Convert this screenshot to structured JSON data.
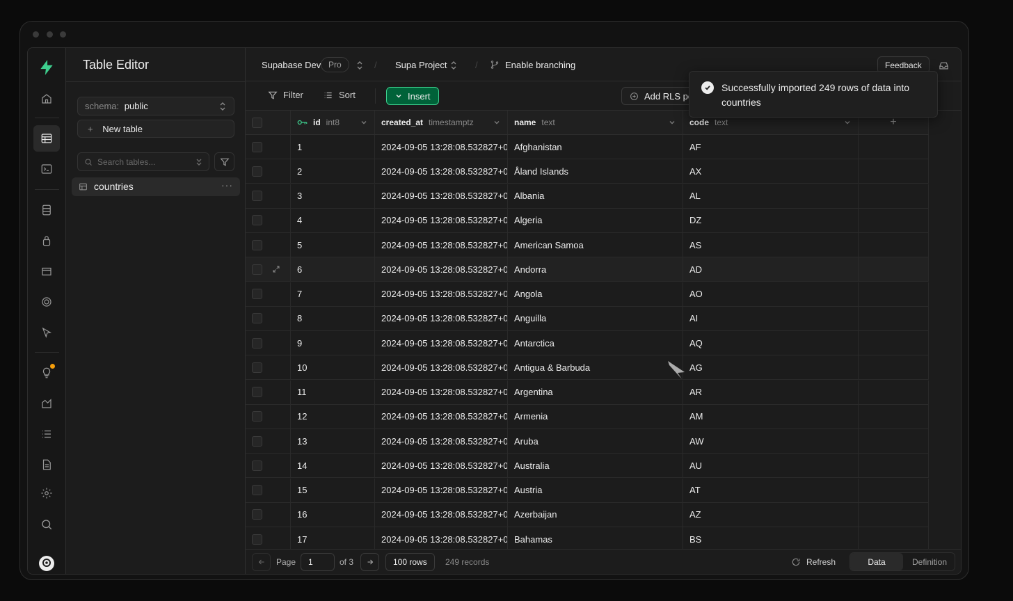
{
  "sidebar": {
    "title": "Table Editor",
    "schema_label": "schema:",
    "schema_value": "public",
    "new_table": "New table",
    "search_placeholder": "Search tables...",
    "table_item": "countries"
  },
  "topbar": {
    "org": "Supabase Dev",
    "plan": "Pro",
    "project": "Supa Project",
    "branching": "Enable branching",
    "feedback": "Feedback"
  },
  "toolbar": {
    "filter": "Filter",
    "sort": "Sort",
    "insert": "Insert",
    "rls": "Add RLS policy"
  },
  "columns": [
    {
      "name": "id",
      "type": "int8"
    },
    {
      "name": "created_at",
      "type": "timestamptz"
    },
    {
      "name": "name",
      "type": "text"
    },
    {
      "name": "code",
      "type": "text"
    }
  ],
  "rows": [
    {
      "id": "1",
      "created_at": "2024-09-05 13:28:08.532827+0",
      "name": "Afghanistan",
      "code": "AF"
    },
    {
      "id": "2",
      "created_at": "2024-09-05 13:28:08.532827+0",
      "name": "Åland Islands",
      "code": "AX"
    },
    {
      "id": "3",
      "created_at": "2024-09-05 13:28:08.532827+0",
      "name": "Albania",
      "code": "AL"
    },
    {
      "id": "4",
      "created_at": "2024-09-05 13:28:08.532827+0",
      "name": "Algeria",
      "code": "DZ"
    },
    {
      "id": "5",
      "created_at": "2024-09-05 13:28:08.532827+0",
      "name": "American Samoa",
      "code": "AS"
    },
    {
      "id": "6",
      "created_at": "2024-09-05 13:28:08.532827+0",
      "name": "Andorra",
      "code": "AD"
    },
    {
      "id": "7",
      "created_at": "2024-09-05 13:28:08.532827+0",
      "name": "Angola",
      "code": "AO"
    },
    {
      "id": "8",
      "created_at": "2024-09-05 13:28:08.532827+0",
      "name": "Anguilla",
      "code": "AI"
    },
    {
      "id": "9",
      "created_at": "2024-09-05 13:28:08.532827+0",
      "name": "Antarctica",
      "code": "AQ"
    },
    {
      "id": "10",
      "created_at": "2024-09-05 13:28:08.532827+0",
      "name": "Antigua & Barbuda",
      "code": "AG"
    },
    {
      "id": "11",
      "created_at": "2024-09-05 13:28:08.532827+0",
      "name": "Argentina",
      "code": "AR"
    },
    {
      "id": "12",
      "created_at": "2024-09-05 13:28:08.532827+0",
      "name": "Armenia",
      "code": "AM"
    },
    {
      "id": "13",
      "created_at": "2024-09-05 13:28:08.532827+0",
      "name": "Aruba",
      "code": "AW"
    },
    {
      "id": "14",
      "created_at": "2024-09-05 13:28:08.532827+0",
      "name": "Australia",
      "code": "AU"
    },
    {
      "id": "15",
      "created_at": "2024-09-05 13:28:08.532827+0",
      "name": "Austria",
      "code": "AT"
    },
    {
      "id": "16",
      "created_at": "2024-09-05 13:28:08.532827+0",
      "name": "Azerbaijan",
      "code": "AZ"
    },
    {
      "id": "17",
      "created_at": "2024-09-05 13:28:08.532827+0",
      "name": "Bahamas",
      "code": "BS"
    }
  ],
  "footer": {
    "page_label": "Page",
    "page_value": "1",
    "of_pages": "of 3",
    "rows_per_page": "100 rows",
    "records": "249 records",
    "refresh": "Refresh",
    "tab_data": "Data",
    "tab_definition": "Definition"
  },
  "toast": {
    "message": "Successfully imported 249 rows of data into countries"
  },
  "colors": {
    "accent": "#3ecf8e",
    "insert_bg": "#006239",
    "notification_dot": "#f59e0b"
  }
}
